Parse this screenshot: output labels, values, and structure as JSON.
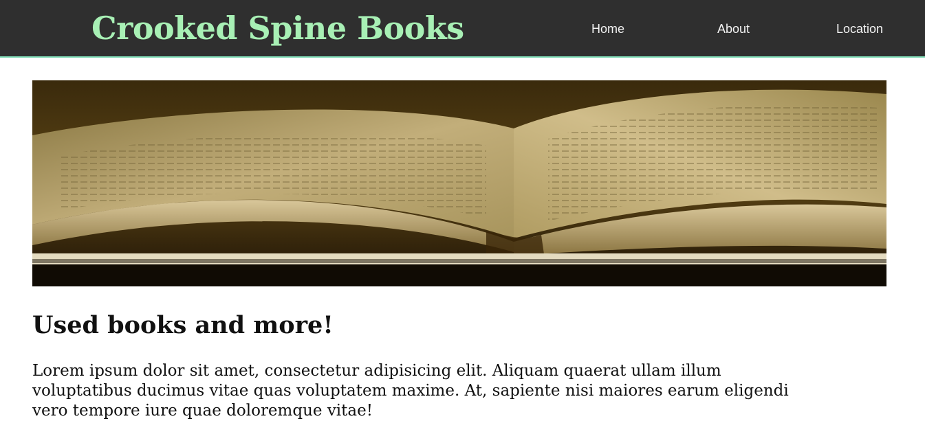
{
  "header": {
    "logo": "Crooked Spine Books",
    "nav": [
      {
        "label": "Home"
      },
      {
        "label": "About"
      },
      {
        "label": "Location"
      }
    ]
  },
  "hero": {
    "image": "open-old-book-photo"
  },
  "main": {
    "headline": "Used books and more!",
    "intro": "Lorem ipsum dolor sit amet, consectetur adipisicing elit. Aliquam quaerat ullam illum voluptatibus ducimus vitae quas voluptatem maxime. At, sapiente nisi maiores earum eligendi vero tempore iure quae doloremque vitae!"
  },
  "colors": {
    "header_bg": "#2f2f2f",
    "logo": "#a8f0b5",
    "header_border": "#7fdcb6",
    "nav_text": "#f2f2f2",
    "body_text": "#111111"
  }
}
